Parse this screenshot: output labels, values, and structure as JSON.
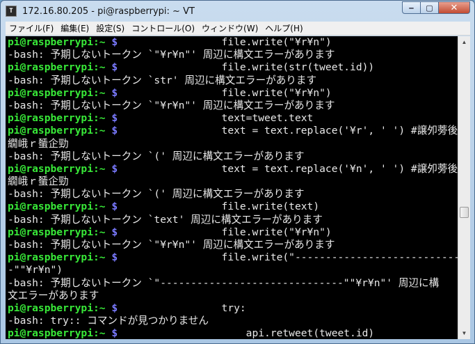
{
  "window": {
    "title": "172.16.80.205 - pi@raspberrypi: ~ VT",
    "icon_label": "T",
    "buttons": {
      "minimize": "‒",
      "maximize": "▢",
      "close": "✕"
    }
  },
  "menu": [
    "ファイル(F)",
    "編集(E)",
    "設定(S)",
    "コントロール(O)",
    "ウィンドウ(W)",
    "ヘルプ(H)"
  ],
  "prompt": {
    "user_host": "pi@raspberrypi",
    "path": ":~ ",
    "symbol": "$"
  },
  "terminal_lines": [
    {
      "type": "prompt",
      "cmd": "                 file.write(\"¥r¥n\")"
    },
    {
      "type": "out",
      "text": "-bash: 予期しないトークン `\"¥r¥n\"' 周辺に構文エラーがあります"
    },
    {
      "type": "prompt",
      "cmd": "                 file.write(str(tweet.id))"
    },
    {
      "type": "out",
      "text": "-bash: 予期しないトークン `str' 周辺に構文エラーがあります"
    },
    {
      "type": "prompt",
      "cmd": "                 file.write(\"¥r¥n\")"
    },
    {
      "type": "out",
      "text": "-bash: 予期しないトークン `\"¥r¥n\"' 周辺に構文エラーがあります"
    },
    {
      "type": "prompt",
      "cmd": "                 text=tweet.text"
    },
    {
      "type": "prompt",
      "cmd": "                 text = text.replace('¥r', ' ') #譲夘蒡後さ繝ｼ"
    },
    {
      "type": "out",
      "text": "繝峨ｒ蜑企勁"
    },
    {
      "type": "out",
      "text": "-bash: 予期しないトークン `(' 周辺に構文エラーがあります"
    },
    {
      "type": "prompt",
      "cmd": "                 text = text.replace('¥n', ' ') #譲夘蒡後さ繝ｼ"
    },
    {
      "type": "out",
      "text": "繝峨ｒ蜑企勁"
    },
    {
      "type": "out",
      "text": "-bash: 予期しないトークン `(' 周辺に構文エラーがあります"
    },
    {
      "type": "prompt",
      "cmd": "                 file.write(text)"
    },
    {
      "type": "out",
      "text": "-bash: 予期しないトークン `text' 周辺に構文エラーがあります"
    },
    {
      "type": "prompt",
      "cmd": "                 file.write(\"¥r¥n\")"
    },
    {
      "type": "out",
      "text": "-bash: 予期しないトークン `\"¥r¥n\"' 周辺に構文エラーがあります"
    },
    {
      "type": "prompt",
      "cmd": "                 file.write(\"------------------------------"
    },
    {
      "type": "out",
      "text": "-\"\"¥r¥n\")"
    },
    {
      "type": "out",
      "text": "-bash: 予期しないトークン `\"------------------------------\"\"¥r¥n\"' 周辺に構"
    },
    {
      "type": "out",
      "text": "文エラーがあります"
    },
    {
      "type": "prompt",
      "cmd": "                 try:"
    },
    {
      "type": "out",
      "text": "-bash: try:: コマンドが見つかりません"
    },
    {
      "type": "prompt",
      "cmd": "                     api.retweet(tweet.id)"
    }
  ],
  "colors": {
    "prompt_user": "#38e838",
    "prompt_dollar": "#7a7aff",
    "terminal_bg": "#000000",
    "terminal_fg": "#e8e8e8"
  }
}
